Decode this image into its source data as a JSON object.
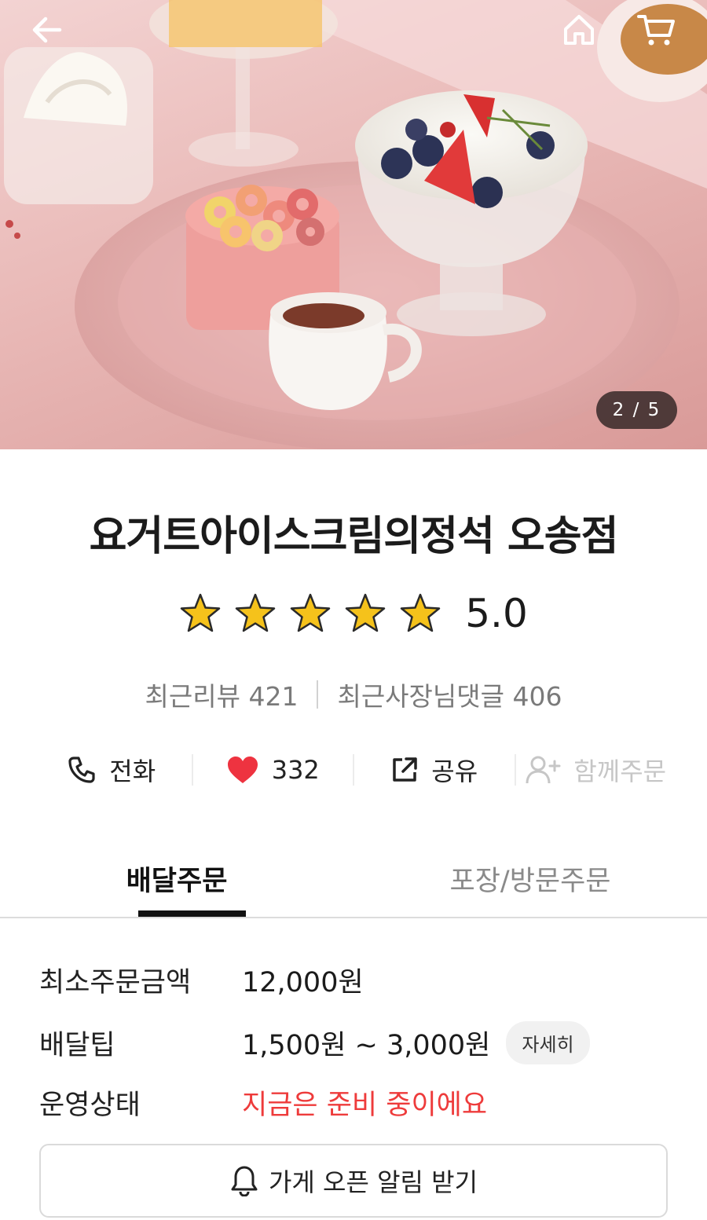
{
  "gallery": {
    "counter": "2 / 5"
  },
  "store": {
    "name": "요거트아이스크림의정석 오송점",
    "rating": "5.0",
    "rating_value": 5,
    "rating_max": 5,
    "recent_reviews": "최근리뷰 421",
    "recent_owner_replies": "최근사장님댓글 406"
  },
  "actions": {
    "call": "전화",
    "likes": "332",
    "share": "공유",
    "group_order": "함께주문"
  },
  "tabs": [
    {
      "label": "배달주문",
      "active": true
    },
    {
      "label": "포장/방문주문",
      "active": false
    }
  ],
  "info": {
    "min_order_label": "최소주문금액",
    "min_order_value": "12,000원",
    "delivery_tip_label": "배달팁",
    "delivery_tip_value": "1,500원 ~ 3,000원",
    "detail_label": "자세히",
    "status_label": "운영상태",
    "status_value": "지금은 준비 중이에요"
  },
  "notify_button": "가게 오픈 알림 받기",
  "colors": {
    "star": "#f5c21b",
    "heart": "#ee3340",
    "alert": "#ee3b3b",
    "tab_active": "#111111"
  },
  "icons": [
    "back-arrow-icon",
    "home-icon",
    "cart-icon",
    "star-icon",
    "phone-icon",
    "heart-icon",
    "share-icon",
    "add-user-icon",
    "bell-icon"
  ]
}
